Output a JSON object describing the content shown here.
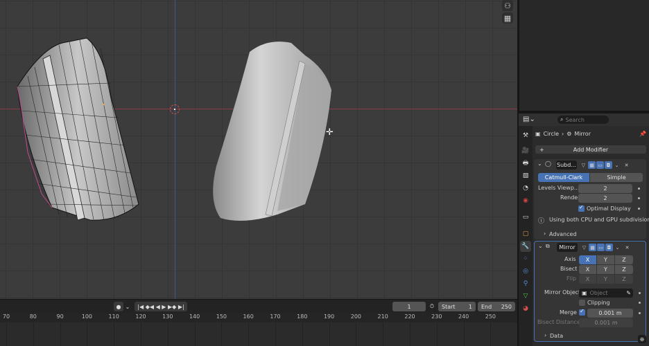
{
  "timeline": {
    "current_frame": "1",
    "start_label": "Start",
    "start_value": "1",
    "end_label": "End",
    "end_value": "250",
    "ticks": [
      "70",
      "80",
      "90",
      "100",
      "110",
      "120",
      "130",
      "140",
      "150",
      "160",
      "170",
      "180",
      "190",
      "200",
      "210",
      "220",
      "230",
      "240",
      "250"
    ]
  },
  "properties": {
    "search_placeholder": "Search",
    "breadcrumb_object": "Circle",
    "breadcrumb_modifier": "Mirror",
    "add_modifier_label": "Add Modifier",
    "subdivision": {
      "name": "Subd...",
      "catmull_label": "Catmull-Clark",
      "simple_label": "Simple",
      "levels_viewport_label": "Levels Viewp...",
      "levels_viewport_value": "2",
      "render_label": "Render",
      "render_value": "2",
      "optimal_display_label": "Optimal Display",
      "info_text": "Using both CPU and GPU subdivision",
      "advanced_label": "Advanced"
    },
    "mirror": {
      "name": "Mirror",
      "axis_label": "Axis",
      "bisect_label": "Bisect",
      "flip_label": "Flip",
      "x": "X",
      "y": "Y",
      "z": "Z",
      "mirror_object_label": "Mirror Object",
      "mirror_object_placeholder": "Object",
      "clipping_label": "Clipping",
      "merge_label": "Merge",
      "merge_value": "0.001 m",
      "bisect_distance_label": "Bisect Distance",
      "bisect_distance_value": "0.001 m",
      "data_label": "Data"
    }
  },
  "colors": {
    "accent": "#4772b3",
    "x_axis": "#8a3a44",
    "y_axis": "#3a5a96"
  }
}
